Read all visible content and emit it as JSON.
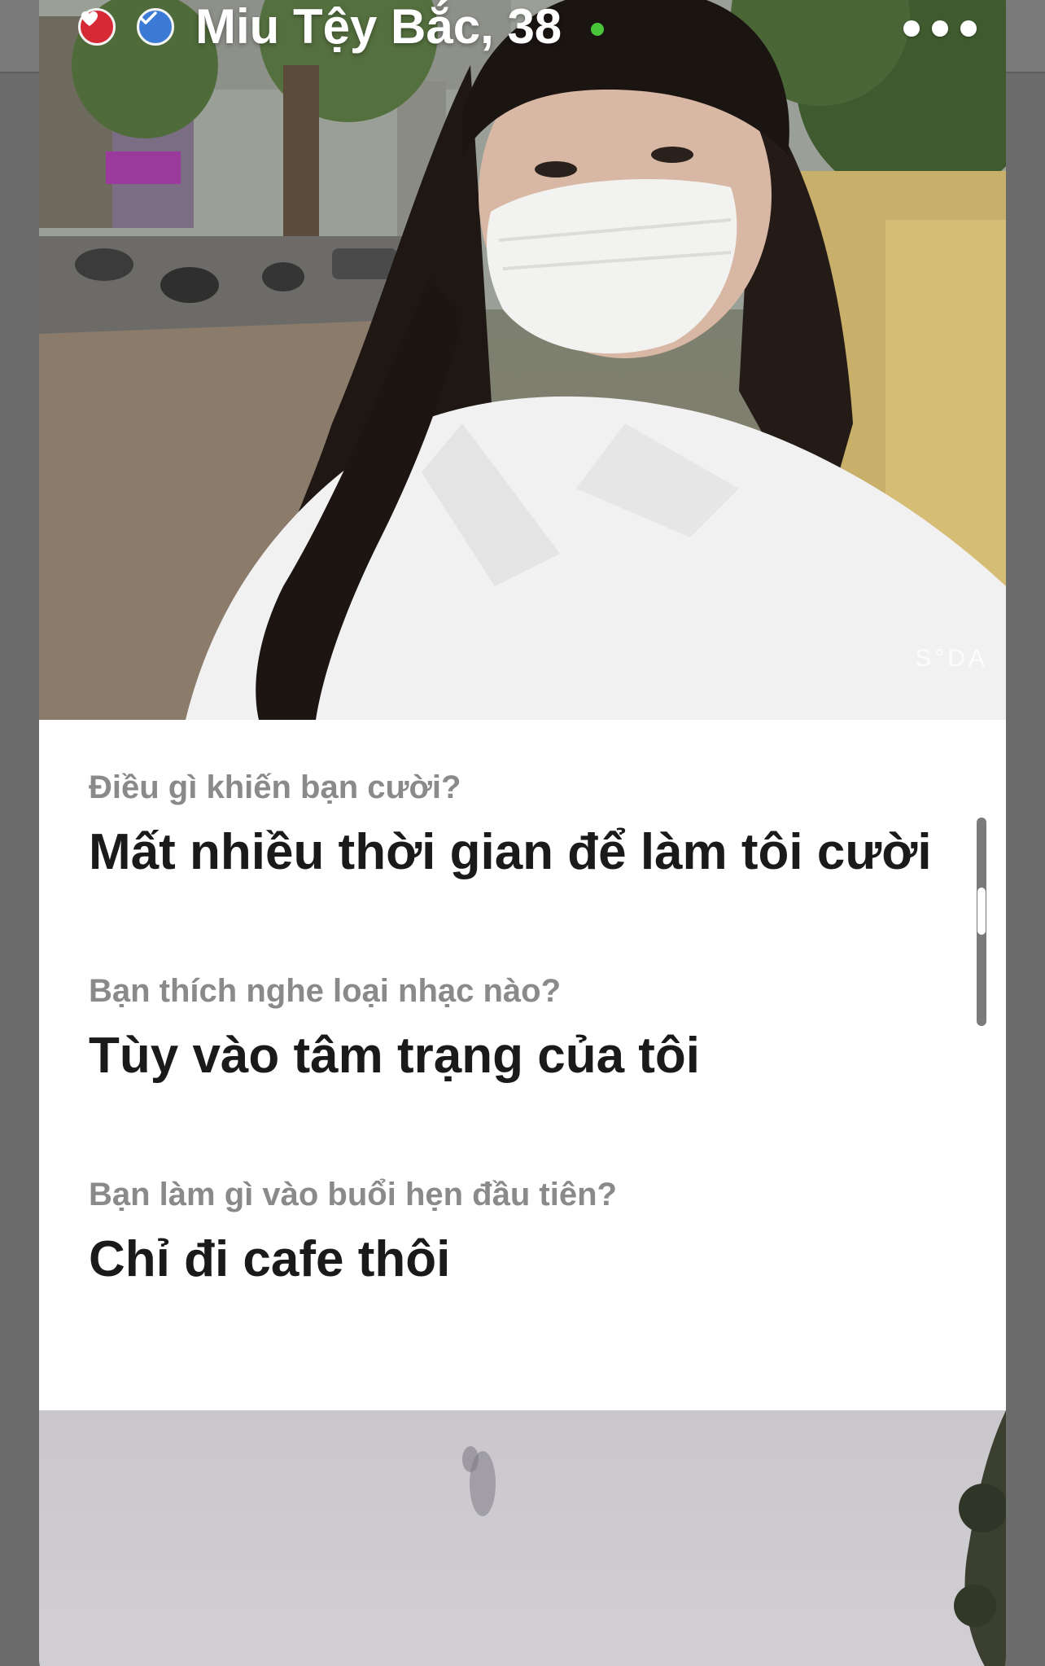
{
  "profile": {
    "name_age": "Miu Tệy Bắc, 38",
    "online": true,
    "badges": [
      "heart-badge",
      "verified-badge"
    ],
    "photo_watermark": "S°DA"
  },
  "prompts": [
    {
      "question": "Điều gì khiến bạn cười?",
      "answer": "Mất nhiều thời gian để làm tôi cười"
    },
    {
      "question": "Bạn thích nghe loại nhạc nào?",
      "answer": "Tùy vào tâm trạng của tôi"
    },
    {
      "question": "Bạn làm gì vào buổi hẹn đầu tiên?",
      "answer": "Chỉ đi cafe thôi"
    }
  ],
  "colors": {
    "online_dot": "#49c53a",
    "heart_badge": "#d52a35",
    "verified_badge": "#3b7bd6",
    "question_text": "#8a8a8a",
    "answer_text": "#1a1a1a"
  },
  "icons": [
    "heart-icon",
    "checkmark-icon",
    "more-options-icon"
  ]
}
